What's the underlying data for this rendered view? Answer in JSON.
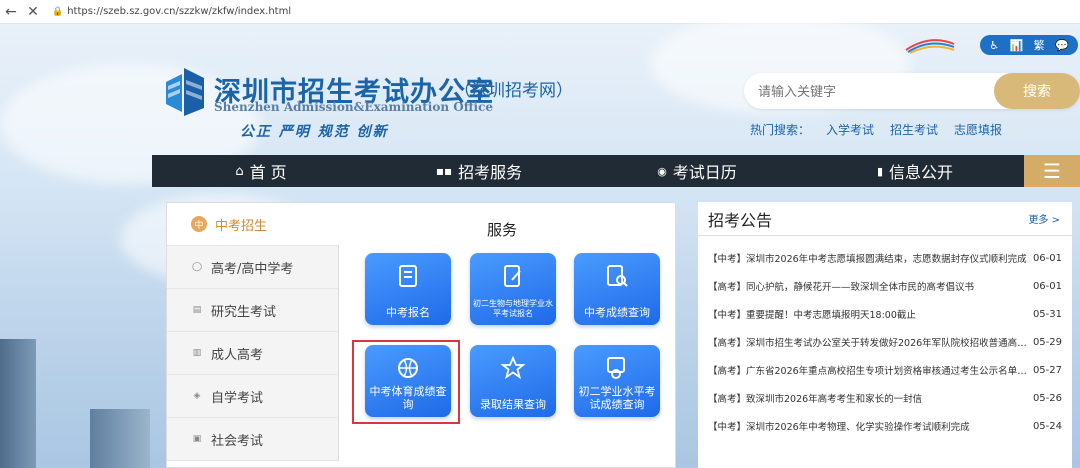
{
  "browser": {
    "url": "https://szeb.sz.gov.cn/szzkw/zkfw/index.html"
  },
  "header": {
    "title": "深圳市招生考试办公室",
    "subtitle": "（深圳招考网）",
    "title_en": "Shenzhen Admission&Examination Office",
    "slogan": "公正 严明 规范 创新",
    "tools": [
      "♿",
      "📊",
      "繁",
      "💬"
    ]
  },
  "search": {
    "placeholder": "请输入关键字",
    "button": "搜索"
  },
  "hot": {
    "label": "热门搜索：",
    "links": [
      "入学考试",
      "招生考试",
      "志愿填报"
    ]
  },
  "nav": {
    "items": [
      "首 页",
      "招考服务",
      "考试日历",
      "信息公开"
    ],
    "menu_icon": "☰"
  },
  "sidebar": {
    "items": [
      "中考招生",
      "高考/高中学考",
      "研究生考试",
      "成人高考",
      "自学考试",
      "社会考试"
    ]
  },
  "services": {
    "title": "服务",
    "tiles": [
      "中考报名",
      "初二生物与地理学业水平考试报名",
      "中考成绩查询",
      "中考体育成绩查询",
      "录取结果查询",
      "初二学业水平考试成绩查询"
    ]
  },
  "notices": {
    "title": "招考公告",
    "more": "更多 >",
    "items": [
      {
        "text": "【中考】深圳市2026年中考志愿填报圆满结束，志愿数据封存仪式顺利完成",
        "date": "06-01"
      },
      {
        "text": "【高考】同心护航，静候花开——致深圳全体市民的高考倡议书",
        "date": "06-01"
      },
      {
        "text": "【中考】重要提醒！中考志愿填报明天18:00截止",
        "date": "05-31"
      },
      {
        "text": "【高考】深圳市招生考试办公室关于转发做好2026年军队院校招收普通高中毕...",
        "date": "05-29"
      },
      {
        "text": "【高考】广东省2026年重点高校招生专项计划资格审核通过考生公示名单（深...",
        "date": "05-27"
      },
      {
        "text": "【高考】致深圳市2026年高考考生和家长的一封信",
        "date": "05-26"
      },
      {
        "text": "【中考】深圳市2026年中考物理、化学实验操作考试顺利完成",
        "date": "05-24"
      }
    ]
  }
}
